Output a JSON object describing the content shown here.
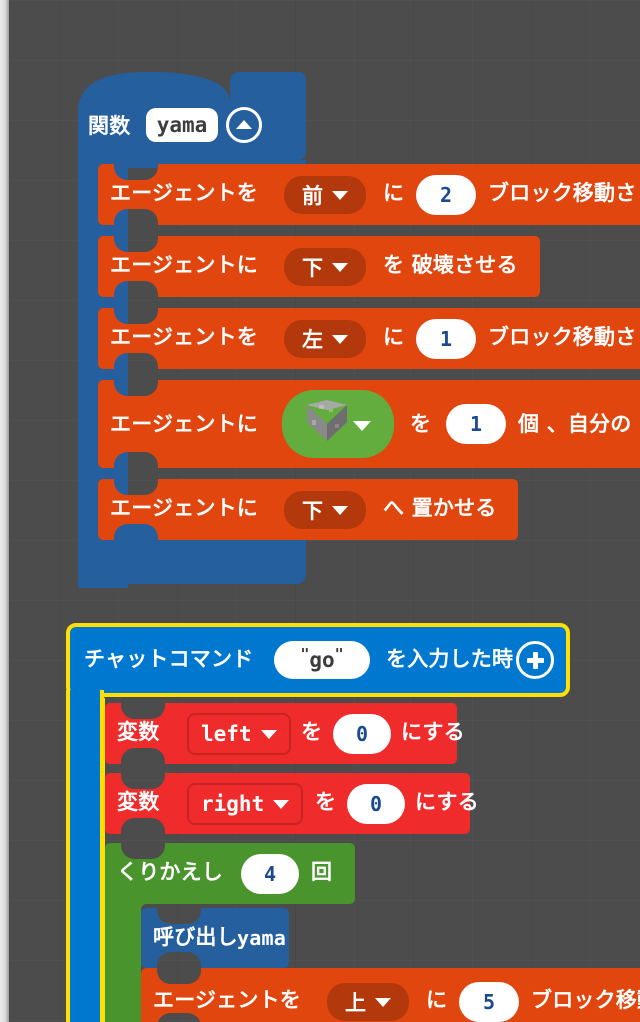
{
  "app": {
    "editor": "makecode-minecraft-block-editor",
    "canvas_background": "#4c4c4c"
  },
  "colors": {
    "functions": "#255f9e",
    "functions_dark": "#1d4c7e",
    "agent": "#e0460e",
    "agent_dark": "#b3380b",
    "event_blue": "#0078d0",
    "variables_red": "#ef2b2b",
    "loops_green": "#4a942e",
    "block_field_green": "#63ac3e",
    "selection_highlight": "#ffe000",
    "field_white": "#ffffff",
    "number_text": "#1b4b8f"
  },
  "scripts": [
    {
      "id": "function-definition",
      "kind": "function-hat",
      "label": "関数",
      "name_field": "yama",
      "collapse_icon": "chevron-up-circle-icon",
      "statements": [
        {
          "id": "agent-move-1",
          "kind": "agent-move",
          "text_before": "エージェントを",
          "dropdown": "前",
          "text_mid": "に",
          "number": "2",
          "text_after": "ブロック移動さ"
        },
        {
          "id": "agent-destroy",
          "kind": "agent-destroy",
          "text_before": "エージェントに",
          "dropdown": "下",
          "text_after": "を 破壊させる"
        },
        {
          "id": "agent-move-2",
          "kind": "agent-move",
          "text_before": "エージェントを",
          "dropdown": "左",
          "text_mid": "に",
          "number": "1",
          "text_after": "ブロック移動さ"
        },
        {
          "id": "agent-set-slot",
          "kind": "agent-set-slot",
          "text_before": "エージェントに",
          "block_icon": "stone-cube-icon",
          "text_mid": "を",
          "number": "1",
          "text_after": "個 、自分の"
        },
        {
          "id": "agent-place",
          "kind": "agent-place",
          "text_before": "エージェントに",
          "dropdown": "下",
          "text_after": "へ 置かせる"
        }
      ]
    },
    {
      "id": "chat-command-event",
      "kind": "event-hat",
      "selected": true,
      "text_before": "チャットコマンド",
      "command": "go",
      "text_after": "を入力した時",
      "expand_icon": "plus-circle-icon",
      "statements": [
        {
          "id": "set-variable-left",
          "kind": "set-variable",
          "text_before": "変数",
          "variable": "left",
          "text_mid": "を",
          "value": "0",
          "text_after": "にする"
        },
        {
          "id": "set-variable-right",
          "kind": "set-variable",
          "text_before": "変数",
          "variable": "right",
          "text_mid": "を",
          "value": "0",
          "text_after": "にする"
        },
        {
          "id": "repeat-loop",
          "kind": "repeat",
          "text_before": "くりかえし",
          "count": "4",
          "text_after": "回",
          "statements": [
            {
              "id": "call-function",
              "kind": "call-function",
              "text_before": "呼び出し",
              "name": "yama"
            },
            {
              "id": "agent-move-3",
              "kind": "agent-move",
              "text_before": "エージェントを",
              "dropdown": "上",
              "text_mid": "に",
              "number": "5",
              "text_after": "ブロック移動"
            }
          ]
        }
      ]
    }
  ]
}
